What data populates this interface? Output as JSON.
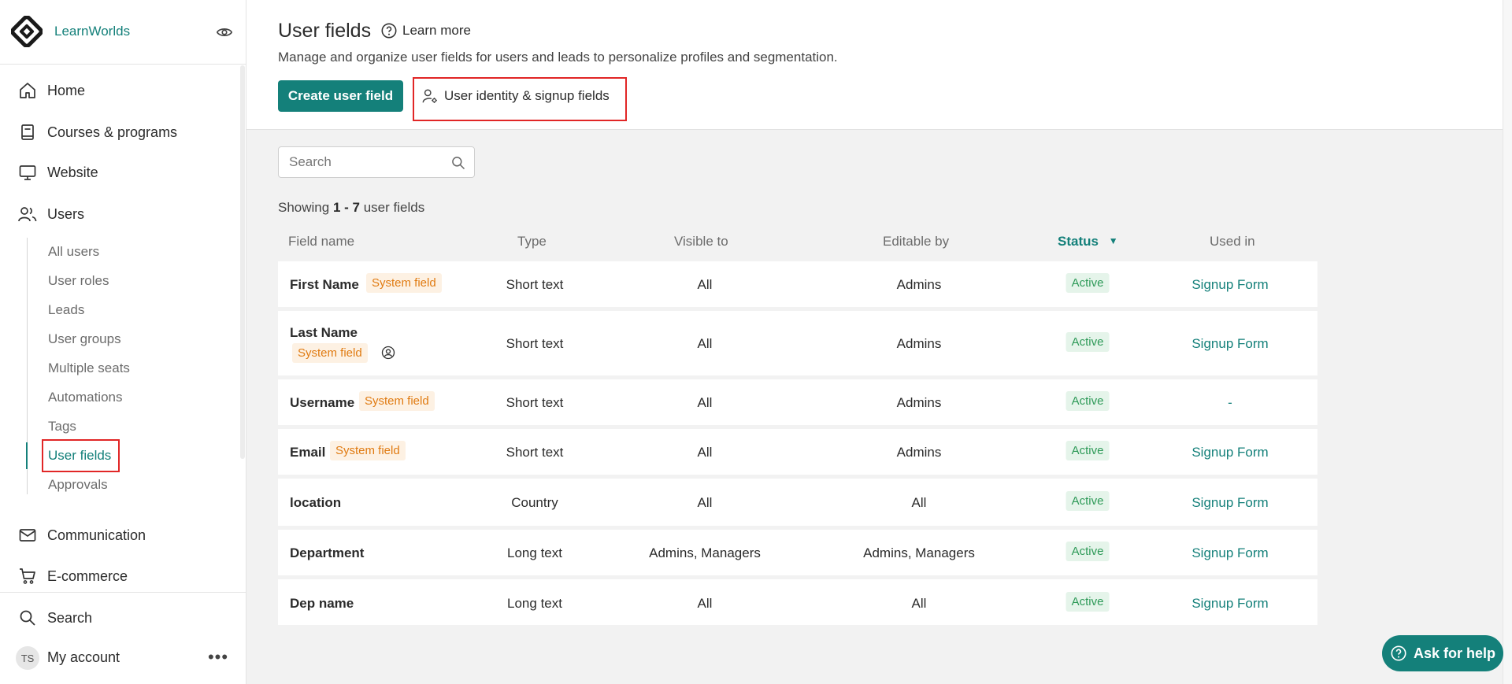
{
  "brand": {
    "name": "LearnWorlds"
  },
  "nav": {
    "home": "Home",
    "courses": "Courses & programs",
    "website": "Website",
    "users": "Users",
    "communication": "Communication",
    "ecommerce": "E-commerce",
    "search": "Search",
    "account": "My account",
    "account_initials": "TS"
  },
  "users_submenu": [
    "All users",
    "User roles",
    "Leads",
    "User groups",
    "Multiple seats",
    "Automations",
    "Tags",
    "User fields",
    "Approvals"
  ],
  "header": {
    "title": "User fields",
    "learn_more": "Learn more",
    "subtitle": "Manage and organize user fields for users and leads to personalize profiles and segmentation.",
    "create_button": "Create user field",
    "identity_button": "User identity & signup fields"
  },
  "search": {
    "placeholder": "Search"
  },
  "showing": {
    "prefix": "Showing",
    "range": "1 - 7",
    "suffix": "user fields"
  },
  "table": {
    "columns": [
      "Field name",
      "Type",
      "Visible to",
      "Editable by",
      "Status",
      "Used in"
    ],
    "rows": [
      {
        "name": "First Name",
        "badge": "System field",
        "type": "Short text",
        "visible": "All",
        "editable": "Admins",
        "status": "Active",
        "used_in": "Signup Form"
      },
      {
        "name": "Last Name",
        "badge": "System field",
        "type": "Short text",
        "visible": "All",
        "editable": "Admins",
        "status": "Active",
        "used_in": "Signup Form"
      },
      {
        "name": "Username",
        "badge": "System field",
        "type": "Short text",
        "visible": "All",
        "editable": "Admins",
        "status": "Active",
        "used_in": "-"
      },
      {
        "name": "Email",
        "badge": "System field",
        "type": "Short text",
        "visible": "All",
        "editable": "Admins",
        "status": "Active",
        "used_in": "Signup Form"
      },
      {
        "name": "location",
        "badge": "",
        "type": "Country",
        "visible": "All",
        "editable": "All",
        "status": "Active",
        "used_in": "Signup Form"
      },
      {
        "name": "Department",
        "badge": "",
        "type": "Long text",
        "visible": "Admins, Managers",
        "editable": "Admins, Managers",
        "status": "Active",
        "used_in": "Signup Form"
      },
      {
        "name": "Dep name",
        "badge": "",
        "type": "Long text",
        "visible": "All",
        "editable": "All",
        "status": "Active",
        "used_in": "Signup Form"
      }
    ]
  },
  "help": {
    "label": "Ask for help"
  },
  "colors": {
    "accent": "#14807a",
    "highlight": "#e12626",
    "system_badge": "#e07b12",
    "status_active": "#2e9a58"
  }
}
